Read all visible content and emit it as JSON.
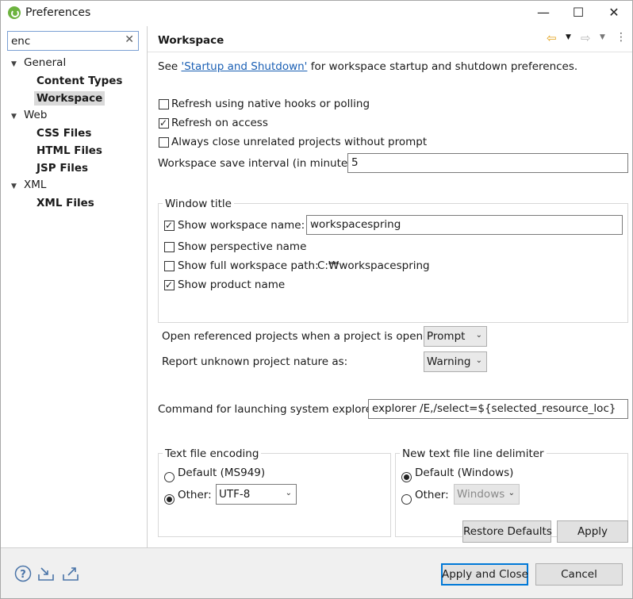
{
  "window": {
    "title": "Preferences",
    "minimize_glyph": "—",
    "maximize_glyph": "☐",
    "close_glyph": "✕"
  },
  "search": {
    "value": "enc",
    "clear_glyph": "✕"
  },
  "tree": {
    "general": "General",
    "content_types": "Content Types",
    "workspace": "Workspace",
    "web": "Web",
    "css_files": "CSS Files",
    "html_files": "HTML Files",
    "jsp_files": "JSP Files",
    "xml": "XML",
    "xml_files": "XML Files"
  },
  "page": {
    "title": "Workspace",
    "intro_prefix": "See ",
    "intro_link": "'Startup and Shutdown'",
    "intro_suffix": " for workspace startup and shutdown preferences.",
    "refresh_native": {
      "label": "Refresh using native hooks or polling",
      "checked": false
    },
    "refresh_access": {
      "label": "Refresh on access",
      "checked": true
    },
    "always_close": {
      "label": "Always close unrelated projects without prompt",
      "checked": false
    },
    "save_interval": {
      "label": "Workspace save interval (in minutes):",
      "value": "5"
    },
    "window_title": {
      "group_label": "Window title",
      "show_ws_name": {
        "label": "Show workspace name:",
        "checked": true,
        "value": "workspacespring"
      },
      "show_perspective": {
        "label": "Show perspective name",
        "checked": false
      },
      "show_full_path": {
        "label": "Show full workspace path:",
        "checked": false,
        "value": "C:₩workspacespring"
      },
      "show_product": {
        "label": "Show product name",
        "checked": true
      }
    },
    "open_referenced": {
      "label": "Open referenced projects when a project is opened:",
      "value": "Prompt"
    },
    "report_unknown": {
      "label": "Report unknown project nature as:",
      "value": "Warning"
    },
    "command": {
      "label": "Command for launching system explorer:",
      "value": "explorer /E,/select=${selected_resource_loc}"
    },
    "encoding": {
      "group_label": "Text file encoding",
      "default_label": "Default (MS949)",
      "other_label": "Other:",
      "other_value": "UTF-8",
      "selected": "other"
    },
    "delimiter": {
      "group_label": "New text file line delimiter",
      "default_label": "Default (Windows)",
      "other_label": "Other:",
      "other_value": "Windows",
      "selected": "default"
    },
    "restore_defaults": "Restore Defaults",
    "apply": "Apply"
  },
  "footer": {
    "apply_close": "Apply and Close",
    "cancel": "Cancel"
  },
  "icons": {
    "help": "help-icon",
    "import": "import-icon",
    "export": "export-icon",
    "back": "back-arrow-icon",
    "forward": "forward-arrow-icon",
    "menu": "view-menu-icon"
  },
  "colors": {
    "nav_back": "#e3a21a",
    "link": "#1a5fb4",
    "accent": "#0078d7"
  }
}
